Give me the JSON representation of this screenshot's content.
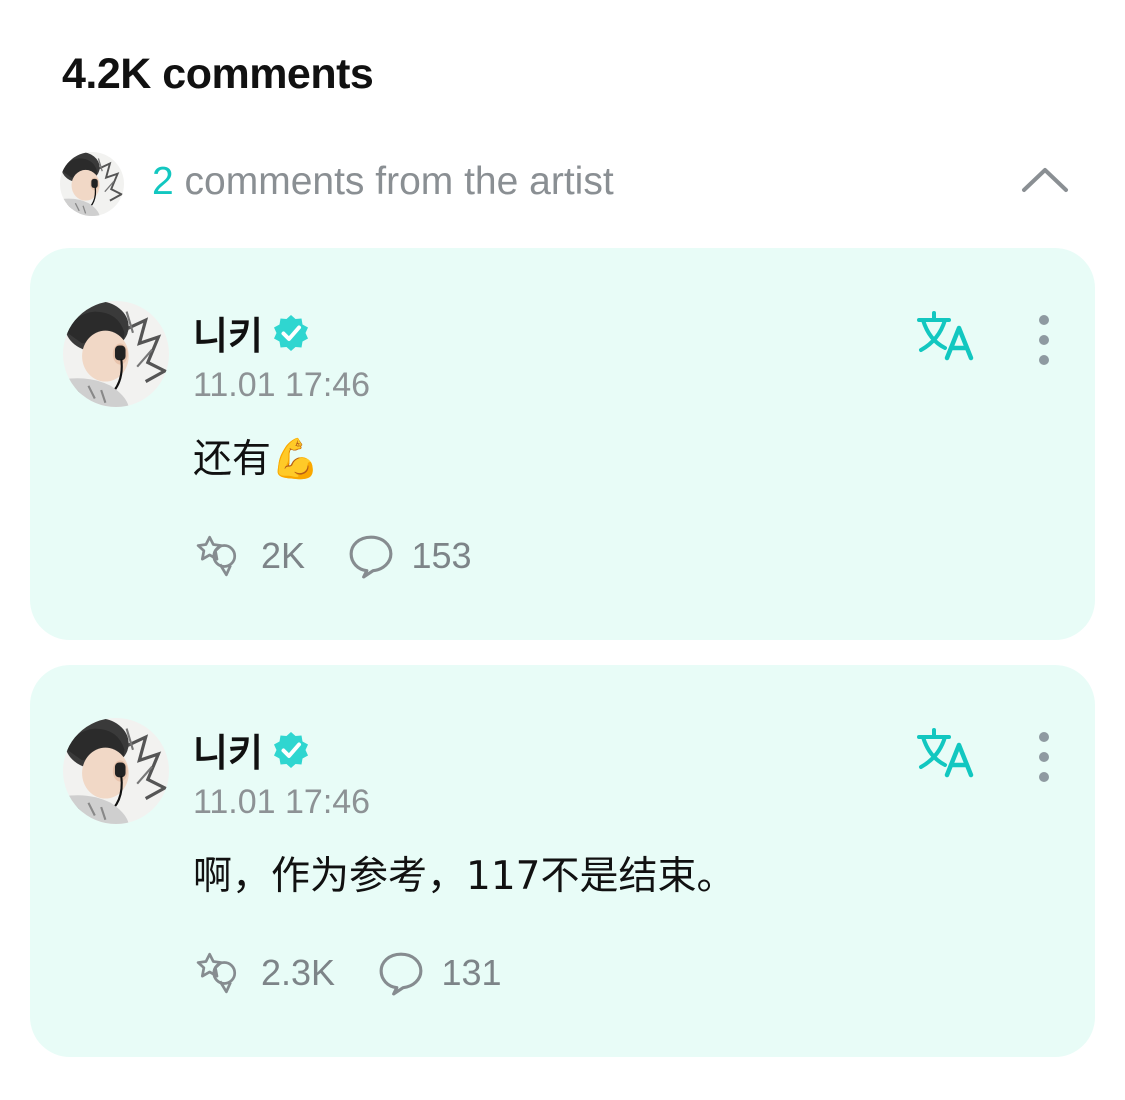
{
  "header": {
    "comment_count_label": "4.2K comments"
  },
  "artist_summary": {
    "count": "2",
    "label": " comments from the artist"
  },
  "comments": [
    {
      "author": "니키",
      "timestamp": "11.01 17:46",
      "text": "还有💪",
      "likes": "2K",
      "replies": "153"
    },
    {
      "author": "니키",
      "timestamp": "11.01 17:46",
      "text": "啊，作为参考，117不是结束。",
      "likes": "2.3K",
      "replies": "131"
    }
  ],
  "colors": {
    "accent": "#12c7c0",
    "card_background": "#e8fcf7",
    "muted_text": "#8a8f93"
  },
  "icons": [
    "chevron-up-icon",
    "verified-badge-icon",
    "translate-icon",
    "more-vertical-icon",
    "like-icon",
    "reply-bubble-icon"
  ]
}
